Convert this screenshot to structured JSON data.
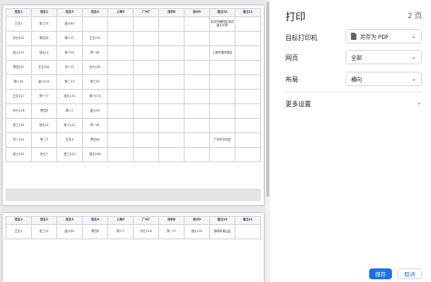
{
  "dialog": {
    "title": "打印",
    "page_count": "2 页",
    "destination": {
      "label": "目标打印机",
      "value": "另存为 PDF"
    },
    "pages": {
      "label": "网页",
      "value": "全部"
    },
    "layout": {
      "label": "布局",
      "value": "横向"
    },
    "more_settings": "更多设置",
    "save_button": "保存",
    "cancel_button": "取消"
  },
  "preview": {
    "headers": [
      "姓名1",
      "姓名2",
      "姓名3",
      "姓名4",
      "上海5",
      "广州7",
      "深圳8",
      "杭州9",
      "备注10",
      "备注11"
    ],
    "page1_rows": [
      [
        "王五1",
        "张三21",
        "赵六44",
        "",
        "",
        "",
        "",
        "",
        "北京市朝阳区测试路100号",
        ""
      ],
      [
        "孙七101",
        "李四31",
        "周八71",
        "王五151",
        "",
        "",
        "",
        "",
        "",
        ""
      ],
      [
        "赵六121",
        "钱九11",
        "吴十41",
        "郑一61",
        "",
        "",
        "",
        "",
        "上海市浦东新区",
        ""
      ],
      [
        "李四231",
        "王五161",
        "刘一71",
        "孙七191",
        "",
        "",
        "",
        "",
        "",
        ""
      ],
      [
        "周八51",
        "赵六141",
        "陈二19",
        "张三97",
        "",
        "",
        "",
        "",
        "",
        ""
      ],
      [
        "王五417",
        "郑一77",
        "钱九131",
        "吴十173",
        "",
        "",
        "",
        "",
        "",
        ""
      ],
      [
        "孙七118",
        "李四8",
        "周八7",
        "赵六20",
        "",
        "",
        "",
        "",
        "",
        ""
      ],
      [
        "张三141",
        "钱九21",
        "吴十111",
        "郑一91",
        "",
        "",
        "",
        "",
        "",
        ""
      ],
      [
        "刘一191",
        "陈二3",
        "王五9",
        "李四44",
        "",
        "",
        "",
        "",
        "广州市天河区",
        ""
      ],
      [
        "赵六192",
        "孙七7",
        "张三124",
        "钱九160",
        "",
        "",
        "",
        "",
        "",
        ""
      ]
    ],
    "page2_rows": [
      [
        "王五1",
        "张三21",
        "赵六44",
        "李四8",
        "周八7",
        "孙七118",
        "郑一77",
        "钱九131",
        "深圳市南山区",
        ""
      ]
    ]
  }
}
